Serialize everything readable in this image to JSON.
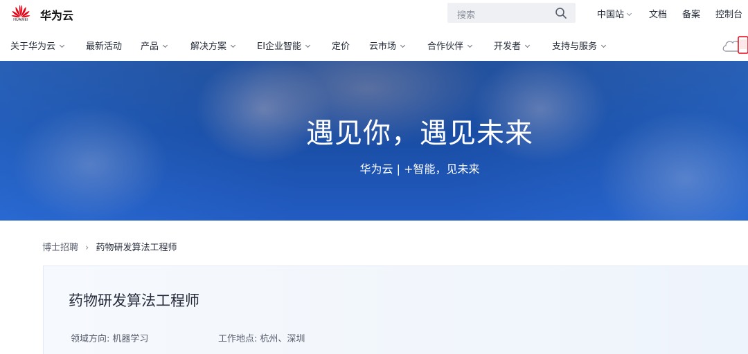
{
  "topbar": {
    "logo_text": "HUAWEI",
    "brand": "华为云",
    "search_placeholder": "搜索",
    "links": [
      "中国站",
      "文档",
      "备案",
      "控制台"
    ]
  },
  "nav": {
    "items": [
      "关于华为云",
      "最新活动",
      "产品",
      "解决方案",
      "EI企业智能",
      "定价",
      "云市场",
      "合作伙伴",
      "开发者",
      "支持与服务"
    ]
  },
  "banner": {
    "title": "遇见你，遇见未来",
    "subtitle": "华为云 | +智能，见未来"
  },
  "breadcrumb": {
    "parent": "博士招聘",
    "separator": "›",
    "current": "药物研发算法工程师"
  },
  "job": {
    "title": "药物研发算法工程师",
    "field_label": "领域方向:",
    "field_value": "机器学习",
    "location_label": "工作地点:",
    "location_value": "杭州、深圳"
  },
  "colors": {
    "brand_red": "#e60012",
    "banner_blue": "#1c4b95",
    "card_bg": "#eef4fc"
  }
}
